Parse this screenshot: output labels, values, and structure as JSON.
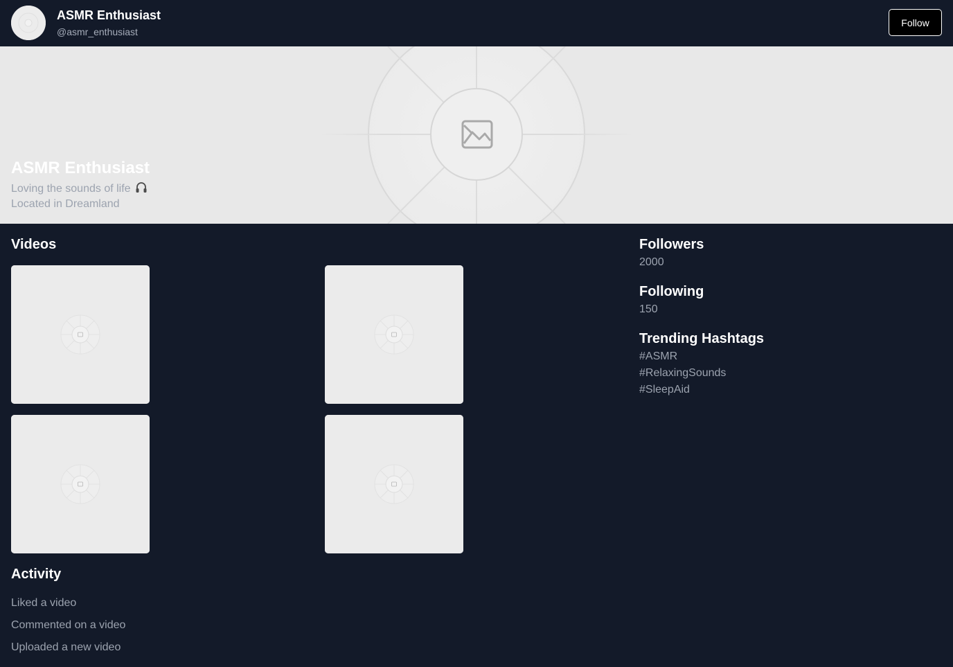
{
  "header": {
    "name": "ASMR Enthusiast",
    "handle": "@asmr_enthusiast",
    "follow_label": "Follow"
  },
  "banner": {
    "name": "ASMR Enthusiast",
    "bio": "Loving the sounds of life",
    "bio_icon": "headphones-icon",
    "location": "Located in Dreamland"
  },
  "videos": {
    "title": "Videos",
    "count": 4
  },
  "activity": {
    "title": "Activity",
    "items": [
      "Liked a video",
      "Commented on a video",
      "Uploaded a new video"
    ]
  },
  "sidebar": {
    "followers_label": "Followers",
    "followers_value": "2000",
    "following_label": "Following",
    "following_value": "150",
    "hashtags_label": "Trending Hashtags",
    "hashtags": [
      "#ASMR",
      "#RelaxingSounds",
      "#SleepAid"
    ]
  },
  "colors": {
    "background": "#131a29",
    "placeholder": "#e8e8e8",
    "muted_text": "#9ca3af",
    "button_bg": "#000000"
  }
}
